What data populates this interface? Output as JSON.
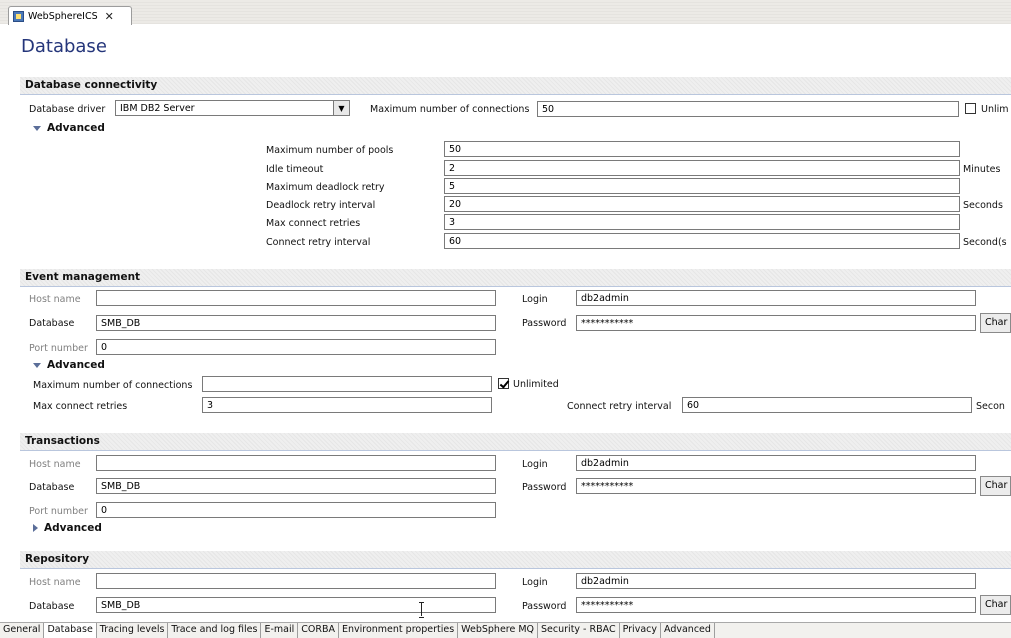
{
  "editor_tab": {
    "label": "WebSphereICS"
  },
  "page_title": "Database",
  "db_connectivity": {
    "header": "Database connectivity",
    "driver_label": "Database driver",
    "driver_value": "IBM DB2 Server",
    "max_conn_label": "Maximum number of connections",
    "max_conn_value": "50",
    "unlimited_label": "Unlim",
    "unlimited_checked": false,
    "advanced_label": "Advanced",
    "advanced": {
      "max_pools_label": "Maximum number of pools",
      "max_pools_value": "50",
      "idle_timeout_label": "Idle timeout",
      "idle_timeout_value": "2",
      "idle_timeout_unit": "Minutes",
      "deadlock_retry_label": "Maximum deadlock retry",
      "deadlock_retry_value": "5",
      "deadlock_interval_label": "Deadlock retry interval",
      "deadlock_interval_value": "20",
      "deadlock_interval_unit": "Seconds",
      "max_connect_retries_label": "Max connect retries",
      "max_connect_retries_value": "3",
      "connect_retry_interval_label": "Connect retry interval",
      "connect_retry_interval_value": "60",
      "connect_retry_interval_unit": "Second(s"
    }
  },
  "event_management": {
    "header": "Event management",
    "host_label": "Host name",
    "host_value": "",
    "database_label": "Database",
    "database_value": "SMB_DB",
    "port_label": "Port number",
    "port_value": "0",
    "login_label": "Login",
    "login_value": "db2admin",
    "password_label": "Password",
    "password_value": "***********",
    "change_label": "Char",
    "advanced_label": "Advanced",
    "max_conn_label": "Maximum number of connections",
    "max_conn_value": "",
    "unlimited_label": "Unlimited",
    "unlimited_checked": true,
    "max_connect_retries_label": "Max connect retries",
    "max_connect_retries_value": "3",
    "connect_retry_interval_label": "Connect retry interval",
    "connect_retry_interval_value": "60",
    "connect_retry_interval_unit": "Secon"
  },
  "transactions": {
    "header": "Transactions",
    "host_label": "Host name",
    "host_value": "",
    "database_label": "Database",
    "database_value": "SMB_DB",
    "port_label": "Port number",
    "port_value": "0",
    "login_label": "Login",
    "login_value": "db2admin",
    "password_label": "Password",
    "password_value": "***********",
    "change_label": "Char",
    "advanced_label": "Advanced"
  },
  "repository": {
    "header": "Repository",
    "host_label": "Host name",
    "host_value": "",
    "database_label": "Database",
    "database_value": "SMB_DB",
    "login_label": "Login",
    "login_value": "db2admin",
    "password_label": "Password",
    "password_value": "***********",
    "change_label": "Char"
  },
  "bottom_tabs": [
    "General",
    "Database",
    "Tracing levels",
    "Trace and log files",
    "E-mail",
    "CORBA",
    "Environment properties",
    "WebSphere MQ",
    "Security - RBAC",
    "Privacy",
    "Advanced"
  ],
  "active_bottom_tab": "Database",
  "colors": {
    "title": "#24357a",
    "section_line": "#b9c6dd",
    "twisty": "#5b6e99"
  }
}
